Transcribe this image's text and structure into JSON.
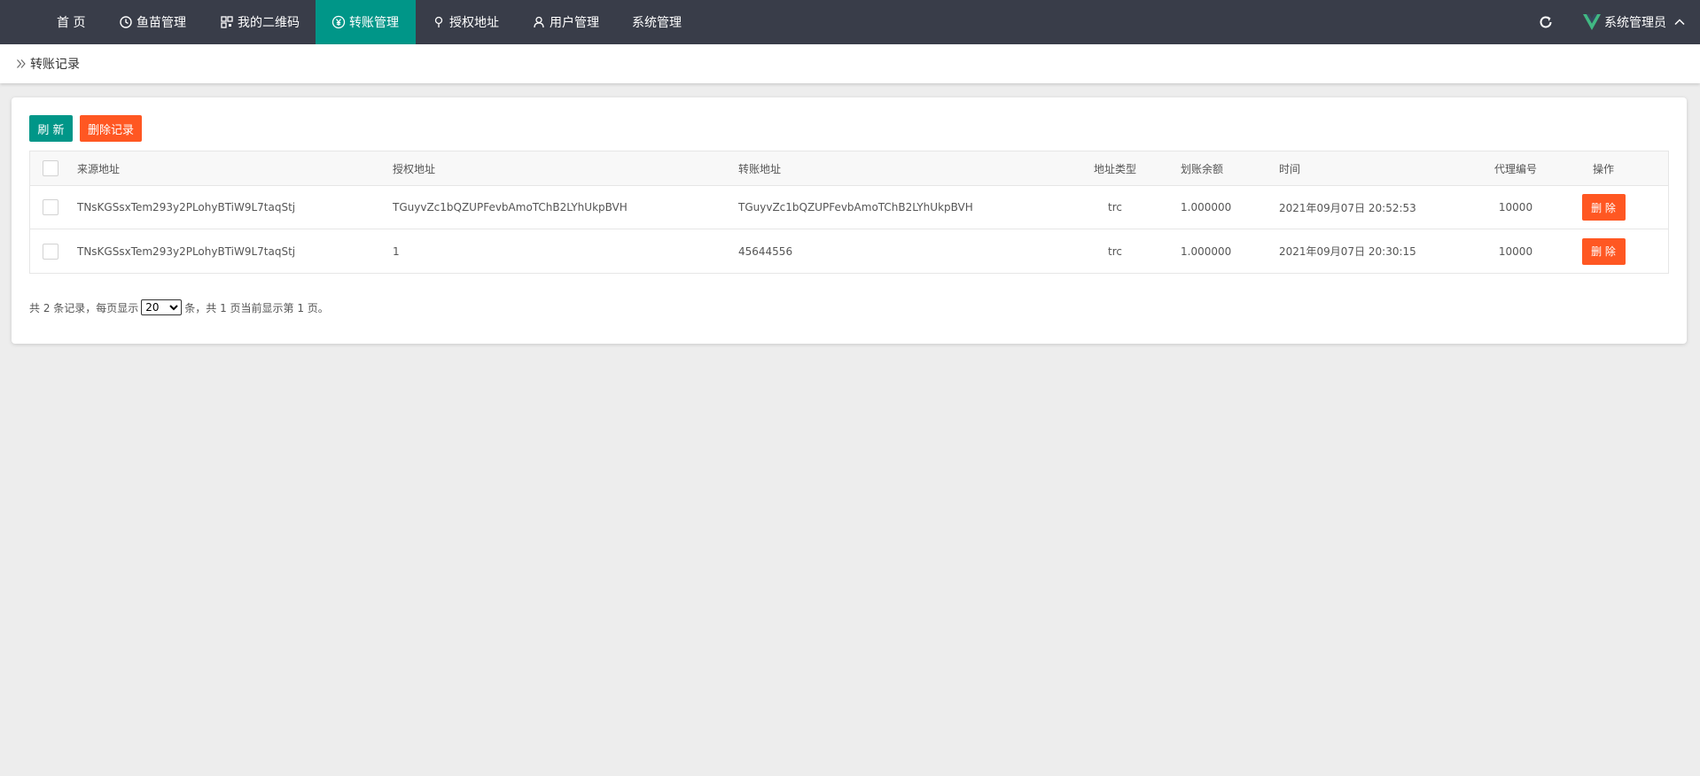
{
  "nav": {
    "items": [
      {
        "label": "首 页",
        "icon": ""
      },
      {
        "label": "鱼苗管理",
        "icon": "clock-icon"
      },
      {
        "label": "我的二维码",
        "icon": "qrcode-icon"
      },
      {
        "label": "转账管理",
        "icon": "yen-icon",
        "active": true
      },
      {
        "label": "授权地址",
        "icon": "location-icon"
      },
      {
        "label": "用户管理",
        "icon": "user-icon"
      },
      {
        "label": "系统管理",
        "icon": ""
      }
    ],
    "admin_label": "系统管理员",
    "active_color": "#009688",
    "bar_color": "#393d49"
  },
  "breadcrumb": {
    "current": "转账记录"
  },
  "toolbar": {
    "refresh_label": "刷 新",
    "clear_label": "删除记录"
  },
  "table": {
    "headers": {
      "source": "来源地址",
      "auth": "授权地址",
      "transfer": "转账地址",
      "type": "地址类型",
      "amount": "划账余额",
      "time": "时间",
      "agent": "代理编号",
      "action": "操作"
    },
    "rows": [
      {
        "source": "TNsKGSsxTem293y2PLohyBTiW9L7taqStj",
        "auth": "TGuyvZc1bQZUPFevbAmoTChB2LYhUkpBVH",
        "transfer": "TGuyvZc1bQZUPFevbAmoTChB2LYhUkpBVH",
        "type": "trc",
        "amount": "1.000000",
        "time": "2021年09月07日 20:52:53",
        "agent": "10000",
        "action": "删 除"
      },
      {
        "source": "TNsKGSsxTem293y2PLohyBTiW9L7taqStj",
        "auth": "1",
        "transfer": "45644556",
        "type": "trc",
        "amount": "1.000000",
        "time": "2021年09月07日 20:30:15",
        "agent": "10000",
        "action": "删 除"
      }
    ]
  },
  "pager": {
    "prefix": "共 2 条记录，每页显示",
    "page_size": "20",
    "suffix": "条，共 1 页当前显示第 1 页。"
  }
}
